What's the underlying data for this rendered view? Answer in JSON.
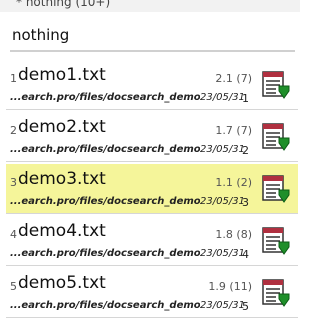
{
  "header": {
    "title": "* nothing (10+)"
  },
  "search": {
    "value": "nothing"
  },
  "results": [
    {
      "number": "1",
      "name": "demo1.txt",
      "score": "2.1 (7)",
      "path": "...earch.pro/files/docsearch_demo",
      "date": "23/05/31",
      "index": "1",
      "selected": false
    },
    {
      "number": "2",
      "name": "demo2.txt",
      "score": "1.7 (7)",
      "path": "...earch.pro/files/docsearch_demo",
      "date": "23/05/31",
      "index": "2",
      "selected": false
    },
    {
      "number": "3",
      "name": "demo3.txt",
      "score": "1.1 (2)",
      "path": "...earch.pro/files/docsearch_demo",
      "date": "23/05/31",
      "index": "3",
      "selected": true
    },
    {
      "number": "4",
      "name": "demo4.txt",
      "score": "1.8 (8)",
      "path": "...earch.pro/files/docsearch_demo",
      "date": "23/05/31",
      "index": "4",
      "selected": false
    },
    {
      "number": "5",
      "name": "demo5.txt",
      "score": "1.9 (11)",
      "path": "...earch.pro/files/docsearch_demo",
      "date": "23/05/31",
      "index": "5",
      "selected": false
    }
  ],
  "icon": "document-download-icon",
  "colors": {
    "selected_row": "#f5f59a",
    "icon_red": "#b03040",
    "icon_green": "#1f8f2a"
  }
}
